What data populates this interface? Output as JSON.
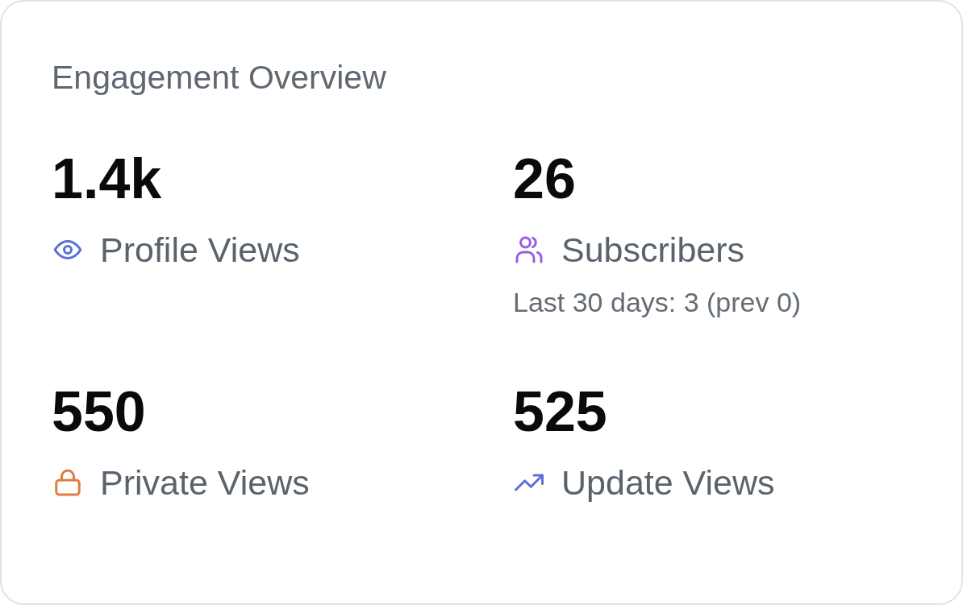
{
  "card": {
    "title": "Engagement Overview"
  },
  "stats": [
    {
      "kind": "eye",
      "value": "1.4k",
      "label": "Profile Views",
      "color": "#5b6fd8"
    },
    {
      "kind": "people",
      "value": "26",
      "label": "Subscribers",
      "color": "#9a5fe0",
      "note": "Last 30 days: 3 (prev 0)"
    },
    {
      "kind": "lock",
      "value": "550",
      "label": "Private Views",
      "color": "#e07c3e"
    },
    {
      "kind": "trend",
      "value": "525",
      "label": "Update Views",
      "color": "#5b6fd8"
    }
  ]
}
